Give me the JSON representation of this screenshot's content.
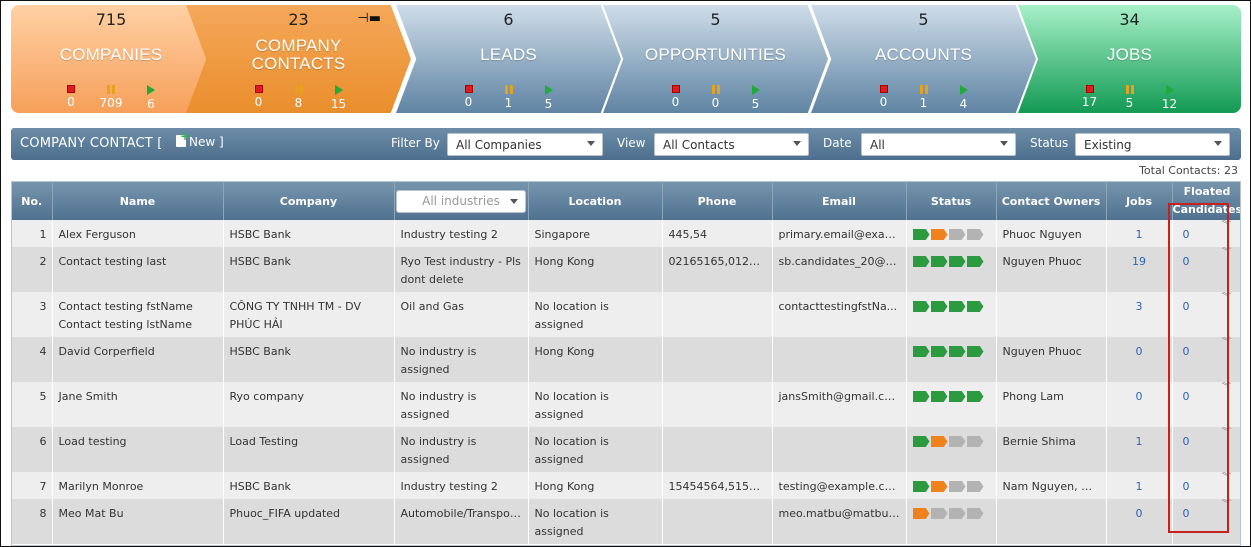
{
  "pipeline": [
    {
      "key": "companies",
      "count": "715",
      "label": "COMPANIES",
      "stats": [
        "0",
        "709",
        "6"
      ]
    },
    {
      "key": "contacts",
      "count": "23",
      "label_line1": "COMPANY",
      "label_line2": "CONTACTS",
      "stats": [
        "0",
        "8",
        "15"
      ]
    },
    {
      "key": "leads",
      "count": "6",
      "label": "LEADS",
      "stats": [
        "0",
        "1",
        "5"
      ]
    },
    {
      "key": "opportunities",
      "count": "5",
      "label": "OPPORTUNITIES",
      "stats": [
        "0",
        "0",
        "5"
      ]
    },
    {
      "key": "accounts",
      "count": "5",
      "label": "ACCOUNTS",
      "stats": [
        "0",
        "1",
        "4"
      ]
    },
    {
      "key": "jobs",
      "count": "34",
      "label": "JOBS",
      "stats": [
        "17",
        "5",
        "12"
      ]
    }
  ],
  "toolbar": {
    "title": "COMPANY CONTACT [",
    "new_label": "New ]",
    "filter_label": "Filter By",
    "filter_value": "All Companies",
    "view_label": "View",
    "view_value": "All Contacts",
    "date_label": "Date",
    "date_value": "All",
    "status_label": "Status",
    "status_value": "Existing"
  },
  "total_contacts": "Total Contacts: 23",
  "columns": {
    "no": "No.",
    "name": "Name",
    "company": "Company",
    "industry_filter": "All industries",
    "location": "Location",
    "phone": "Phone",
    "email": "Email",
    "status": "Status",
    "owners": "Contact Owners",
    "jobs": "Jobs",
    "floated": "Floated Candidates"
  },
  "rows": [
    {
      "no": "1",
      "name": "Alex Ferguson",
      "company": "HSBC Bank",
      "industry": "Industry testing 2",
      "location": "Singapore",
      "phone": "445,54",
      "email": "primary.email@exam...",
      "status": [
        "g",
        "o",
        "x",
        "x"
      ],
      "owners": "Phuoc Nguyen",
      "jobs": "1",
      "floated": "0"
    },
    {
      "no": "2",
      "name": "Contact testing last",
      "company": "HSBC Bank",
      "industry": "Ryo Test industry - Pls dont delete",
      "location": "Hong Kong",
      "phone": "02165165,0122...",
      "email": "sb.candidates_20@y...",
      "status": [
        "g",
        "g",
        "g",
        "g"
      ],
      "owners": "Nguyen Phuoc",
      "jobs": "19",
      "floated": "0"
    },
    {
      "no": "3",
      "name": "Contact testing fstName Contact testing lstName",
      "company": "CÔNG TY TNHH TM - DV PHÚC HẢI",
      "industry": "Oil and Gas",
      "location": "No location is assigned",
      "phone": "",
      "email": "contacttestingfstNa...",
      "status": [
        "g",
        "g",
        "g",
        "g"
      ],
      "owners": "",
      "jobs": "3",
      "floated": "0"
    },
    {
      "no": "4",
      "name": "David Corperfield",
      "company": "HSBC Bank",
      "industry": "No industry is assigned",
      "location": "Hong Kong",
      "phone": "",
      "email": "",
      "status": [
        "g",
        "g",
        "g",
        "g"
      ],
      "owners": "Nguyen Phuoc",
      "jobs": "0",
      "floated": "0"
    },
    {
      "no": "5",
      "name": "Jane Smith",
      "company": "Ryo company",
      "industry": "No industry is assigned",
      "location": "No location is assigned",
      "phone": "",
      "email": "jansSmith@gmail.com",
      "status": [
        "g",
        "g",
        "g",
        "g"
      ],
      "owners": "Phong Lam",
      "jobs": "0",
      "floated": "0"
    },
    {
      "no": "6",
      "name": "Load testing",
      "company": "Load Testing",
      "industry": "No industry is assigned",
      "location": "No location is assigned",
      "phone": "",
      "email": "",
      "status": [
        "g",
        "o",
        "x",
        "x"
      ],
      "owners": "Bernie Shima",
      "jobs": "1",
      "floated": "0"
    },
    {
      "no": "7",
      "name": "Marilyn Monroe",
      "company": "HSBC Bank",
      "industry": "Industry testing 2",
      "location": "Hong Kong",
      "phone": "15454564,5155...",
      "email": "testing@example.com",
      "status": [
        "g",
        "o",
        "x",
        "x"
      ],
      "owners": "Nam Nguyen, N...",
      "jobs": "1",
      "floated": "0"
    },
    {
      "no": "8",
      "name": "Meo Mat Bu",
      "company": "Phuoc_FIFA updated",
      "industry": "Automobile/Transportation",
      "location": "No location is assigned",
      "phone": "",
      "email": "meo.matbu@matbu....",
      "status": [
        "o",
        "x",
        "x",
        "x"
      ],
      "owners": "",
      "jobs": "0",
      "floated": "0"
    }
  ],
  "status_colors": {
    "g": "#2c9a3e",
    "o": "#f0821e",
    "x": "#b3b3b3"
  }
}
